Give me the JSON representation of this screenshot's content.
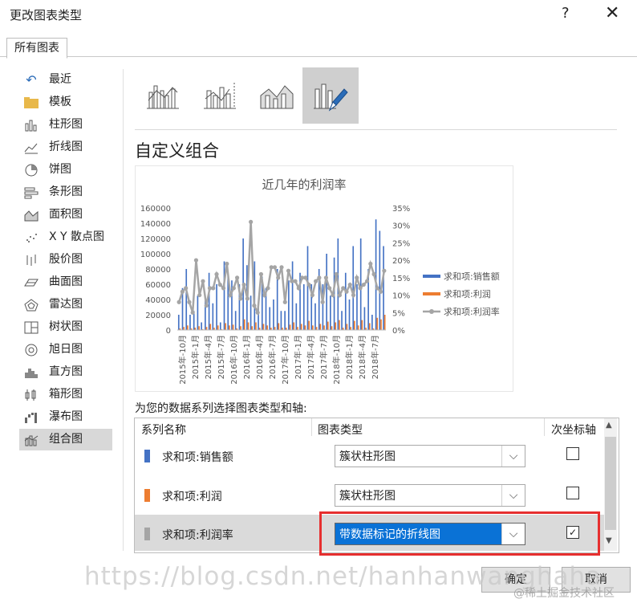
{
  "window": {
    "title": "更改图表类型",
    "help": "?",
    "close": "✕"
  },
  "tabs": [
    {
      "label": "所有图表"
    }
  ],
  "sidebar": {
    "items": [
      {
        "label": "最近",
        "icon": "recent-icon"
      },
      {
        "label": "模板",
        "icon": "folder-icon"
      },
      {
        "label": "柱形图",
        "icon": "column-chart-icon"
      },
      {
        "label": "折线图",
        "icon": "line-chart-icon"
      },
      {
        "label": "饼图",
        "icon": "pie-chart-icon"
      },
      {
        "label": "条形图",
        "icon": "bar-chart-icon"
      },
      {
        "label": "面积图",
        "icon": "area-chart-icon"
      },
      {
        "label": "X Y 散点图",
        "icon": "scatter-chart-icon"
      },
      {
        "label": "股价图",
        "icon": "stock-chart-icon"
      },
      {
        "label": "曲面图",
        "icon": "surface-chart-icon"
      },
      {
        "label": "雷达图",
        "icon": "radar-chart-icon"
      },
      {
        "label": "树状图",
        "icon": "treemap-chart-icon"
      },
      {
        "label": "旭日图",
        "icon": "sunburst-chart-icon"
      },
      {
        "label": "直方图",
        "icon": "histogram-chart-icon"
      },
      {
        "label": "箱形图",
        "icon": "boxwhisker-chart-icon"
      },
      {
        "label": "瀑布图",
        "icon": "waterfall-chart-icon"
      },
      {
        "label": "组合图",
        "icon": "combo-chart-icon",
        "selected": true
      }
    ]
  },
  "main": {
    "heading": "自定义组合",
    "prompt": "为您的数据系列选择图表类型和轴:",
    "table": {
      "headers": [
        "系列名称",
        "图表类型",
        "次坐标轴"
      ],
      "rows": [
        {
          "name": "求和项:销售额",
          "type": "簇状柱形图",
          "secondary": false,
          "color": "#4472c4"
        },
        {
          "name": "求和项:利润",
          "type": "簇状柱形图",
          "secondary": false,
          "color": "#ed7d31"
        },
        {
          "name": "求和项:利润率",
          "type": "带数据标记的折线图",
          "secondary": true,
          "color": "#a5a5a5"
        }
      ]
    }
  },
  "buttons": {
    "ok": "确定",
    "cancel": "取消"
  },
  "watermark": {
    "url": "https://blog.csdn.net/hanhanwanghaha",
    "credit": "@稀土掘金技术社区"
  },
  "chart_data": {
    "type": "bar",
    "title": "近几年的利润率",
    "categories": [
      "2015年-10月",
      "2015年-1月",
      "2015年-4月",
      "2015年-7月",
      "2016年-10月",
      "2016年-1月",
      "2016年-4月",
      "2016年-7月",
      "2017年-10月",
      "2017年-1月",
      "2017年-4月",
      "2017年-7月",
      "2018年-10月",
      "2018年-1月",
      "2018年-4月",
      "2018年-7月"
    ],
    "y_ticks": [
      "160000",
      "140000",
      "120000",
      "100000",
      "80000",
      "60000",
      "40000",
      "20000",
      "0"
    ],
    "y2_ticks": [
      "35%",
      "30%",
      "25%",
      "20%",
      "15%",
      "10%",
      "5%",
      "0%"
    ],
    "ylim": [
      0,
      160000
    ],
    "y2lim": [
      0,
      35
    ],
    "series": [
      {
        "name": "求和项:销售额",
        "kind": "bar",
        "color": "#4472c4",
        "values": [
          20000,
          55000,
          80000,
          20000,
          25000,
          45000,
          10000,
          40000,
          75000,
          35000,
          60000,
          10000,
          90000,
          70000,
          65000,
          25000,
          60000,
          120000,
          85000,
          45000,
          90000,
          30000,
          70000,
          55000,
          30000,
          40000,
          80000,
          25000,
          25000,
          65000,
          90000,
          35000,
          75000,
          60000,
          110000,
          60000,
          35000,
          80000,
          60000,
          100000,
          45000,
          95000,
          120000,
          25000,
          75000,
          40000,
          110000,
          60000,
          120000,
          30000,
          80000,
          20000,
          145000,
          130000,
          110000
        ]
      },
      {
        "name": "求和项:利润",
        "kind": "bar",
        "color": "#ed7d31",
        "values": [
          2000,
          4000,
          6000,
          2000,
          3000,
          5000,
          1000,
          4000,
          8000,
          3000,
          6000,
          1000,
          9000,
          6000,
          7000,
          2000,
          5000,
          14000,
          10000,
          5000,
          10000,
          3000,
          8000,
          6000,
          3000,
          4000,
          9000,
          3000,
          3000,
          7000,
          10000,
          4000,
          8000,
          6000,
          12000,
          6000,
          4000,
          8000,
          6000,
          11000,
          5000,
          10000,
          13000,
          3000,
          8000,
          4000,
          12000,
          6000,
          13000,
          3000,
          9000,
          2000,
          16000,
          14000,
          20000
        ]
      },
      {
        "name": "求和项:利润率",
        "kind": "line",
        "color": "#a5a5a5",
        "values": [
          8,
          11,
          12,
          8,
          5,
          20,
          10,
          14,
          7,
          12,
          12,
          16,
          13,
          12,
          19,
          10,
          12,
          15,
          9,
          13,
          9,
          31,
          7,
          5,
          16,
          10,
          12,
          18,
          18,
          15,
          18,
          8,
          17,
          14,
          14,
          12,
          15,
          15,
          13,
          10,
          14,
          15,
          8,
          15,
          12,
          10,
          16,
          10,
          12,
          11,
          13,
          10,
          15,
          12,
          13,
          14,
          19,
          16,
          12,
          11,
          17
        ]
      }
    ]
  }
}
